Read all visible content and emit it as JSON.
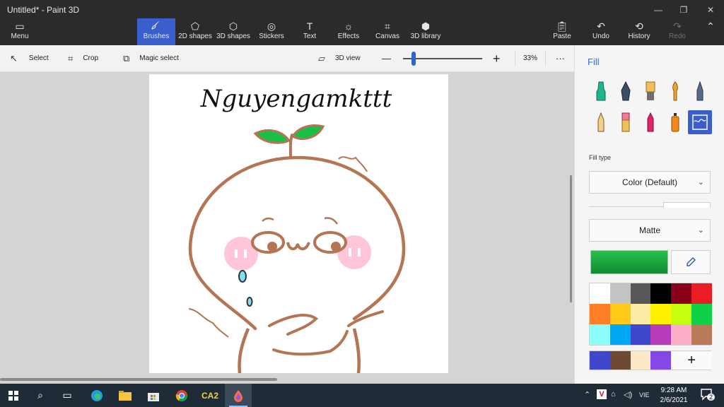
{
  "window": {
    "title": "Untitled* - Paint 3D",
    "minimize": "—",
    "maximize": "❐",
    "close": "✕"
  },
  "ribbon": {
    "menu": "Menu",
    "tabs": [
      "Brushes",
      "2D shapes",
      "3D shapes",
      "Stickers",
      "Text",
      "Effects",
      "Canvas",
      "3D library"
    ],
    "paste": "Paste",
    "undo": "Undo",
    "history": "History",
    "redo": "Redo"
  },
  "toolbar": {
    "select": "Select",
    "crop": "Crop",
    "magic_select": "Magic select",
    "view3d": "3D view",
    "zoom_out": "—",
    "zoom_in": "+",
    "zoom_level": "33%",
    "more": "···"
  },
  "canvas": {
    "signature": "Nguyengamkttt"
  },
  "panel": {
    "title": "Fill",
    "fill_type_label": "Fill type",
    "fill_type_value": "Color (Default)",
    "finish_value": "Matte",
    "current_color": "#19a63f",
    "palette": [
      "#ffffff",
      "#c3c3c3",
      "#585858",
      "#000000",
      "#88001b",
      "#ec1c24",
      "#ff7f27",
      "#ffca18",
      "#fdeca6",
      "#fff200",
      "#c4ff0e",
      "#0ed145",
      "#8cfffb",
      "#00a8f3",
      "#3f48cc",
      "#b83dba",
      "#ffaec8",
      "#b97a57"
    ],
    "custom_colors": [
      "#3f48cc",
      "#6e4a33",
      "#fde8c8",
      "#8348e6"
    ],
    "add_color": "+"
  },
  "taskbar": {
    "app_label": "CA2",
    "lang": "VIE",
    "time": "9:28 AM",
    "date": "2/6/2021",
    "notifications": "2"
  }
}
